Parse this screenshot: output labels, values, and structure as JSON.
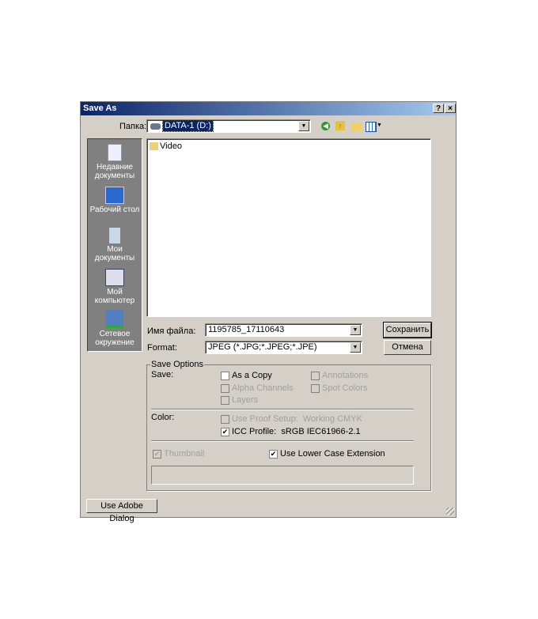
{
  "window": {
    "title": "Save As",
    "help_label": "?",
    "close_label": "×"
  },
  "lookin": {
    "label": "Папка:",
    "value": "DATA-1 (D:)"
  },
  "places": [
    {
      "label": "Недавние документы",
      "icon": "recent-documents-icon"
    },
    {
      "label": "Рабочий стол",
      "icon": "desktop-icon"
    },
    {
      "label": "Мои документы",
      "icon": "my-documents-icon"
    },
    {
      "label": "Мой компьютер",
      "icon": "my-computer-icon"
    },
    {
      "label": "Сетевое окружение",
      "icon": "network-icon"
    }
  ],
  "files": [
    {
      "name": "Video",
      "icon": "folder-icon"
    }
  ],
  "filename": {
    "label": "Имя файла:",
    "value": "1195785_17110643"
  },
  "format": {
    "label": "Format:",
    "value": "JPEG (*.JPG;*.JPEG;*.JPE)"
  },
  "buttons": {
    "save": "Сохранить",
    "cancel": "Отмена",
    "adobe": "Use Adobe Dialog"
  },
  "options": {
    "legend": "Save Options",
    "save_label": "Save:",
    "color_label": "Color:",
    "as_copy": {
      "label": "As a Copy",
      "checked": false,
      "enabled": true
    },
    "alpha": {
      "label": "Alpha Channels",
      "checked": false,
      "enabled": false
    },
    "layers": {
      "label": "Layers",
      "checked": false,
      "enabled": false
    },
    "annotations": {
      "label": "Annotations",
      "checked": false,
      "enabled": false
    },
    "spot": {
      "label": "Spot Colors",
      "checked": false,
      "enabled": false
    },
    "proof": {
      "label": "Use Proof Setup:  Working CMYK",
      "checked": false,
      "enabled": false
    },
    "icc": {
      "label": "ICC Profile:  sRGB IEC61966-2.1",
      "checked": true,
      "enabled": true
    },
    "thumbnail": {
      "label": "Thumbnail",
      "checked": true,
      "enabled": false
    },
    "lowercase": {
      "label": "Use Lower Case Extension",
      "checked": true,
      "enabled": true
    }
  }
}
